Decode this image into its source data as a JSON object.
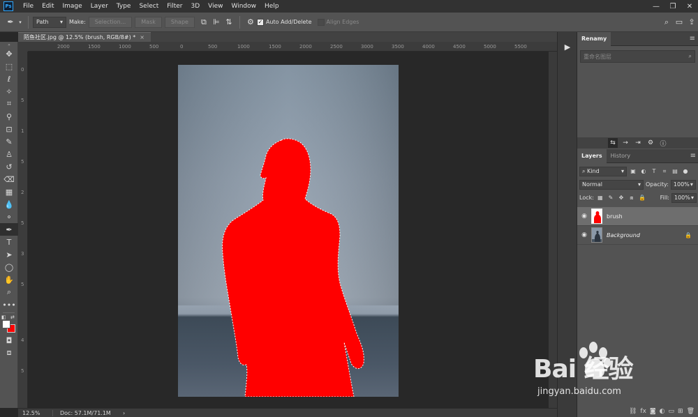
{
  "menubar": {
    "app_logo": "Ps",
    "items": [
      "File",
      "Edit",
      "Image",
      "Layer",
      "Type",
      "Select",
      "Filter",
      "3D",
      "View",
      "Window",
      "Help"
    ]
  },
  "options": {
    "mode": "Path",
    "make_label": "Make:",
    "selection_btn": "Selection...",
    "mask_btn": "Mask",
    "shape_btn": "Shape",
    "auto_add_delete": "Auto Add/Delete",
    "auto_add_delete_checked": true,
    "align_edges": "Align Edges",
    "align_edges_checked": false
  },
  "document": {
    "tab_title": "陌鱼社区.jpg @ 12.5% (brush, RGB/8#) *",
    "close": "×",
    "ruler_h_ticks": [
      "2000",
      "1500",
      "1000",
      "500",
      "0",
      "500",
      "1000",
      "1500",
      "2000",
      "2500",
      "3000",
      "3500",
      "4000",
      "4500",
      "5000",
      "5500"
    ],
    "ruler_v_ticks": [
      "0",
      "5",
      "1",
      "5",
      "2",
      "5",
      "3",
      "5",
      "4",
      "5"
    ]
  },
  "status": {
    "zoom": "12.5%",
    "doc": "Doc: 57.1M/71.1M",
    "arrow": "›"
  },
  "panels": {
    "renamy": {
      "title": "Renamy",
      "search_placeholder": "重命名图层"
    },
    "layers": {
      "tabs": [
        "Layers",
        "History"
      ],
      "filter_kind": "Kind",
      "blend_mode": "Normal",
      "opacity_label": "Opacity:",
      "opacity_value": "100%",
      "lock_label": "Lock:",
      "fill_label": "Fill:",
      "fill_value": "100%",
      "items": [
        {
          "name": "brush",
          "selected": true
        },
        {
          "name": "Background",
          "selected": false,
          "locked": true
        }
      ]
    }
  },
  "watermark": {
    "brand": "Bai 经验",
    "url": "jingyan.baidu.com"
  },
  "colors": {
    "selection_fill": "#ff0000",
    "foreground": "#ffffff",
    "background_color": "#ff0000"
  }
}
